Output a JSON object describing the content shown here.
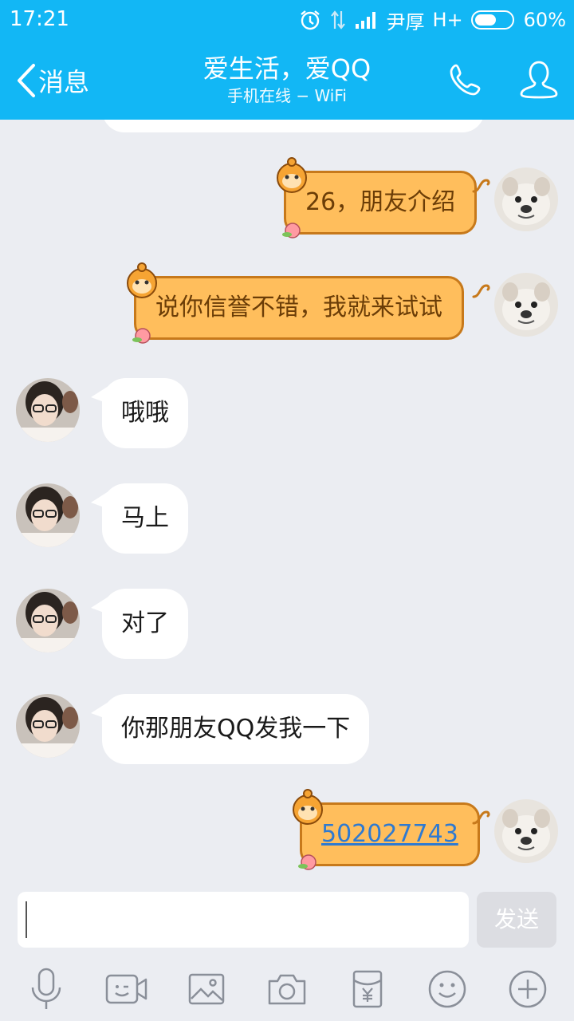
{
  "status": {
    "time": "17:21",
    "carrier": "尹厚",
    "network": "H+",
    "battery_percent": 60,
    "battery_text": "60%"
  },
  "header": {
    "back_label": "消息",
    "title": "爱生活，爱QQ",
    "subtitle": "手机在线 − WiFi"
  },
  "messages": [
    {
      "side": "right",
      "text": "26，朋友介绍"
    },
    {
      "side": "right",
      "text": "说你信誉不错，我就来试试"
    },
    {
      "side": "left",
      "text": "哦哦"
    },
    {
      "side": "left",
      "text": "马上"
    },
    {
      "side": "left",
      "text": "对了"
    },
    {
      "side": "left",
      "text": "你那朋友QQ发我一下"
    },
    {
      "side": "right",
      "text": "502027743"
    }
  ],
  "composer": {
    "value": "",
    "send_label": "发送"
  },
  "toolbar": [
    {
      "name": "voice",
      "icon": "microphone-icon"
    },
    {
      "name": "video",
      "icon": "video-call-icon"
    },
    {
      "name": "image",
      "icon": "image-icon"
    },
    {
      "name": "camera",
      "icon": "camera-icon"
    },
    {
      "name": "red-packet",
      "icon": "red-packet-icon"
    },
    {
      "name": "emoji",
      "icon": "emoji-icon"
    },
    {
      "name": "more",
      "icon": "plus-icon"
    }
  ],
  "colors": {
    "accent": "#12b7f5",
    "chat_bg": "#ebedf2",
    "bubble_monkey": "#ffbe5c",
    "bubble_monkey_border": "#c7791b",
    "link": "#2e7ad1"
  }
}
